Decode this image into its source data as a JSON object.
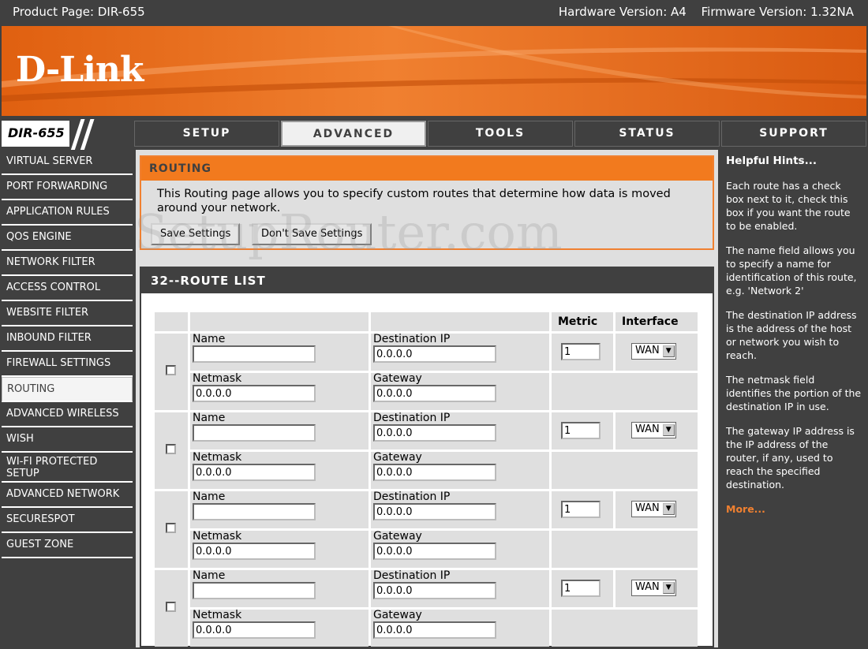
{
  "header": {
    "product": "Product Page: DIR-655",
    "hardware": "Hardware Version: A4",
    "firmware": "Firmware Version: 1.32NA"
  },
  "brand": {
    "logo": "D-Link",
    "model": "DIR-655"
  },
  "tabs": [
    {
      "label": "SETUP"
    },
    {
      "label": "ADVANCED"
    },
    {
      "label": "TOOLS"
    },
    {
      "label": "STATUS"
    },
    {
      "label": "SUPPORT"
    }
  ],
  "sidebar": {
    "items": [
      {
        "label": "VIRTUAL SERVER"
      },
      {
        "label": "PORT FORWARDING"
      },
      {
        "label": "APPLICATION RULES"
      },
      {
        "label": "QOS ENGINE"
      },
      {
        "label": "NETWORK FILTER"
      },
      {
        "label": "ACCESS CONTROL"
      },
      {
        "label": "WEBSITE FILTER"
      },
      {
        "label": "INBOUND FILTER"
      },
      {
        "label": "FIREWALL SETTINGS"
      },
      {
        "label": "ROUTING"
      },
      {
        "label": "ADVANCED WIRELESS"
      },
      {
        "label": "WISH"
      },
      {
        "label": "WI-FI PROTECTED SETUP"
      },
      {
        "label": "ADVANCED NETWORK"
      },
      {
        "label": "SECURESPOT"
      },
      {
        "label": "GUEST ZONE"
      }
    ]
  },
  "routing": {
    "title": "ROUTING",
    "description": "This Routing page allows you to specify custom routes that determine how data is moved around your network.",
    "save_label": "Save Settings",
    "dont_save_label": "Don't Save Settings"
  },
  "watermark": "SetupRouter.com",
  "route_list": {
    "title": "32--ROUTE LIST",
    "metric_header": "Metric",
    "interface_header": "Interface",
    "name_label": "Name",
    "destination_label": "Destination IP",
    "netmask_label": "Netmask",
    "gateway_label": "Gateway",
    "rows": [
      {
        "name": "",
        "destination": "0.0.0.0",
        "netmask": "0.0.0.0",
        "gateway": "0.0.0.0",
        "metric": "1",
        "interface": "WAN"
      },
      {
        "name": "",
        "destination": "0.0.0.0",
        "netmask": "0.0.0.0",
        "gateway": "0.0.0.0",
        "metric": "1",
        "interface": "WAN"
      },
      {
        "name": "",
        "destination": "0.0.0.0",
        "netmask": "0.0.0.0",
        "gateway": "0.0.0.0",
        "metric": "1",
        "interface": "WAN"
      },
      {
        "name": "",
        "destination": "0.0.0.0",
        "netmask": "0.0.0.0",
        "gateway": "0.0.0.0",
        "metric": "1",
        "interface": "WAN"
      }
    ]
  },
  "hints": {
    "title": "Helpful Hints...",
    "items": [
      "Each route has a check box next to it, check this box if you want the route to be enabled.",
      "The name field allows you to specify a name for identification of this route, e.g. 'Network 2'",
      "The destination IP address is the address of the host or network you wish to reach.",
      "The netmask field identifies the portion of the destination IP in use.",
      "The gateway IP address is the IP address of the router, if any, used to reach the specified destination."
    ],
    "more": "More..."
  }
}
